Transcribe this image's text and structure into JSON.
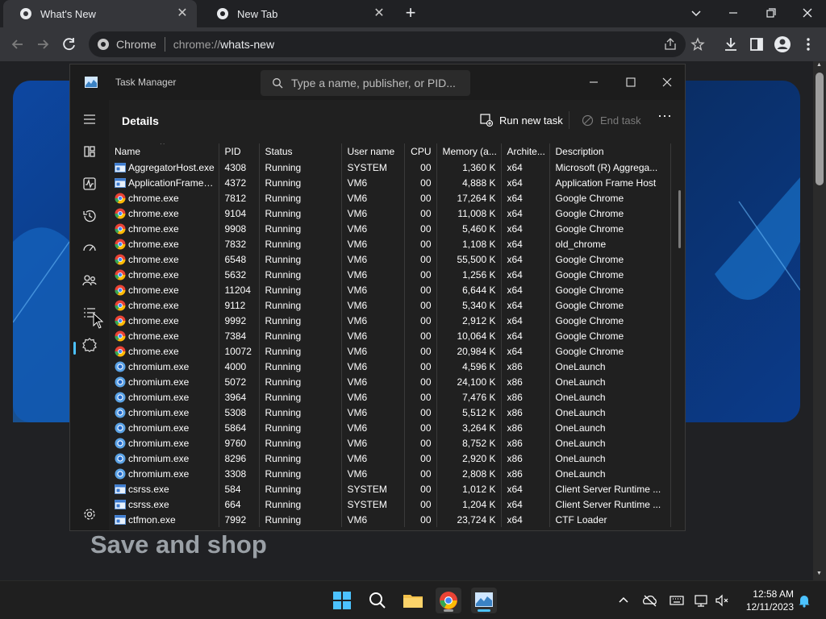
{
  "browser": {
    "tabs": [
      {
        "label": "What's New"
      },
      {
        "label": "New Tab"
      }
    ],
    "omnibox": {
      "site": "Chrome",
      "url_prefix": "chrome://",
      "url_host": "whats-new"
    },
    "page": {
      "headline": "Save and shop"
    }
  },
  "task_manager": {
    "title": "Task Manager",
    "search_placeholder": "Type a name, publisher, or PID...",
    "section_title": "Details",
    "run_new_task": "Run new task",
    "end_task": "End task",
    "columns": [
      "Name",
      "PID",
      "Status",
      "User name",
      "CPU",
      "Memory (a...",
      "Archite...",
      "Description"
    ],
    "rows": [
      {
        "icon": "app",
        "name": "AggregatorHost.exe",
        "pid": "4308",
        "status": "Running",
        "user": "SYSTEM",
        "cpu": "00",
        "mem": "1,360 K",
        "arch": "x64",
        "desc": "Microsoft (R) Aggrega..."
      },
      {
        "icon": "app",
        "name": "ApplicationFrameHo...",
        "pid": "4372",
        "status": "Running",
        "user": "VM6",
        "cpu": "00",
        "mem": "4,888 K",
        "arch": "x64",
        "desc": "Application Frame Host"
      },
      {
        "icon": "chrome",
        "name": "chrome.exe",
        "pid": "7812",
        "status": "Running",
        "user": "VM6",
        "cpu": "00",
        "mem": "17,264 K",
        "arch": "x64",
        "desc": "Google Chrome"
      },
      {
        "icon": "chrome",
        "name": "chrome.exe",
        "pid": "9104",
        "status": "Running",
        "user": "VM6",
        "cpu": "00",
        "mem": "11,008 K",
        "arch": "x64",
        "desc": "Google Chrome"
      },
      {
        "icon": "chrome",
        "name": "chrome.exe",
        "pid": "9908",
        "status": "Running",
        "user": "VM6",
        "cpu": "00",
        "mem": "5,460 K",
        "arch": "x64",
        "desc": "Google Chrome"
      },
      {
        "icon": "chrome",
        "name": "chrome.exe",
        "pid": "7832",
        "status": "Running",
        "user": "VM6",
        "cpu": "00",
        "mem": "1,108 K",
        "arch": "x64",
        "desc": "old_chrome"
      },
      {
        "icon": "chrome",
        "name": "chrome.exe",
        "pid": "6548",
        "status": "Running",
        "user": "VM6",
        "cpu": "00",
        "mem": "55,500 K",
        "arch": "x64",
        "desc": "Google Chrome"
      },
      {
        "icon": "chrome",
        "name": "chrome.exe",
        "pid": "5632",
        "status": "Running",
        "user": "VM6",
        "cpu": "00",
        "mem": "1,256 K",
        "arch": "x64",
        "desc": "Google Chrome"
      },
      {
        "icon": "chrome",
        "name": "chrome.exe",
        "pid": "11204",
        "status": "Running",
        "user": "VM6",
        "cpu": "00",
        "mem": "6,644 K",
        "arch": "x64",
        "desc": "Google Chrome"
      },
      {
        "icon": "chrome",
        "name": "chrome.exe",
        "pid": "9112",
        "status": "Running",
        "user": "VM6",
        "cpu": "00",
        "mem": "5,340 K",
        "arch": "x64",
        "desc": "Google Chrome"
      },
      {
        "icon": "chrome",
        "name": "chrome.exe",
        "pid": "9992",
        "status": "Running",
        "user": "VM6",
        "cpu": "00",
        "mem": "2,912 K",
        "arch": "x64",
        "desc": "Google Chrome"
      },
      {
        "icon": "chrome",
        "name": "chrome.exe",
        "pid": "7384",
        "status": "Running",
        "user": "VM6",
        "cpu": "00",
        "mem": "10,064 K",
        "arch": "x64",
        "desc": "Google Chrome"
      },
      {
        "icon": "chrome",
        "name": "chrome.exe",
        "pid": "10072",
        "status": "Running",
        "user": "VM6",
        "cpu": "00",
        "mem": "20,984 K",
        "arch": "x64",
        "desc": "Google Chrome"
      },
      {
        "icon": "chromium",
        "name": "chromium.exe",
        "pid": "4000",
        "status": "Running",
        "user": "VM6",
        "cpu": "00",
        "mem": "4,596 K",
        "arch": "x86",
        "desc": "OneLaunch"
      },
      {
        "icon": "chromium",
        "name": "chromium.exe",
        "pid": "5072",
        "status": "Running",
        "user": "VM6",
        "cpu": "00",
        "mem": "24,100 K",
        "arch": "x86",
        "desc": "OneLaunch"
      },
      {
        "icon": "chromium",
        "name": "chromium.exe",
        "pid": "3964",
        "status": "Running",
        "user": "VM6",
        "cpu": "00",
        "mem": "7,476 K",
        "arch": "x86",
        "desc": "OneLaunch"
      },
      {
        "icon": "chromium",
        "name": "chromium.exe",
        "pid": "5308",
        "status": "Running",
        "user": "VM6",
        "cpu": "00",
        "mem": "5,512 K",
        "arch": "x86",
        "desc": "OneLaunch"
      },
      {
        "icon": "chromium",
        "name": "chromium.exe",
        "pid": "5864",
        "status": "Running",
        "user": "VM6",
        "cpu": "00",
        "mem": "3,264 K",
        "arch": "x86",
        "desc": "OneLaunch"
      },
      {
        "icon": "chromium",
        "name": "chromium.exe",
        "pid": "9760",
        "status": "Running",
        "user": "VM6",
        "cpu": "00",
        "mem": "8,752 K",
        "arch": "x86",
        "desc": "OneLaunch"
      },
      {
        "icon": "chromium",
        "name": "chromium.exe",
        "pid": "8296",
        "status": "Running",
        "user": "VM6",
        "cpu": "00",
        "mem": "2,920 K",
        "arch": "x86",
        "desc": "OneLaunch"
      },
      {
        "icon": "chromium",
        "name": "chromium.exe",
        "pid": "3308",
        "status": "Running",
        "user": "VM6",
        "cpu": "00",
        "mem": "2,808 K",
        "arch": "x86",
        "desc": "OneLaunch"
      },
      {
        "icon": "app",
        "name": "csrss.exe",
        "pid": "584",
        "status": "Running",
        "user": "SYSTEM",
        "cpu": "00",
        "mem": "1,012 K",
        "arch": "x64",
        "desc": "Client Server Runtime ..."
      },
      {
        "icon": "app",
        "name": "csrss.exe",
        "pid": "664",
        "status": "Running",
        "user": "SYSTEM",
        "cpu": "00",
        "mem": "1,204 K",
        "arch": "x64",
        "desc": "Client Server Runtime ..."
      },
      {
        "icon": "app",
        "name": "ctfmon.exe",
        "pid": "7992",
        "status": "Running",
        "user": "VM6",
        "cpu": "00",
        "mem": "23,724 K",
        "arch": "x64",
        "desc": "CTF Loader"
      }
    ]
  },
  "taskbar": {
    "time": "12:58 AM",
    "date": "12/11/2023"
  },
  "colors": {
    "accent": "#4cc2ff",
    "chrome_red": "#ea4335",
    "chrome_yellow": "#fbbc04",
    "chrome_green": "#34a853",
    "chrome_blue": "#4285f4"
  }
}
